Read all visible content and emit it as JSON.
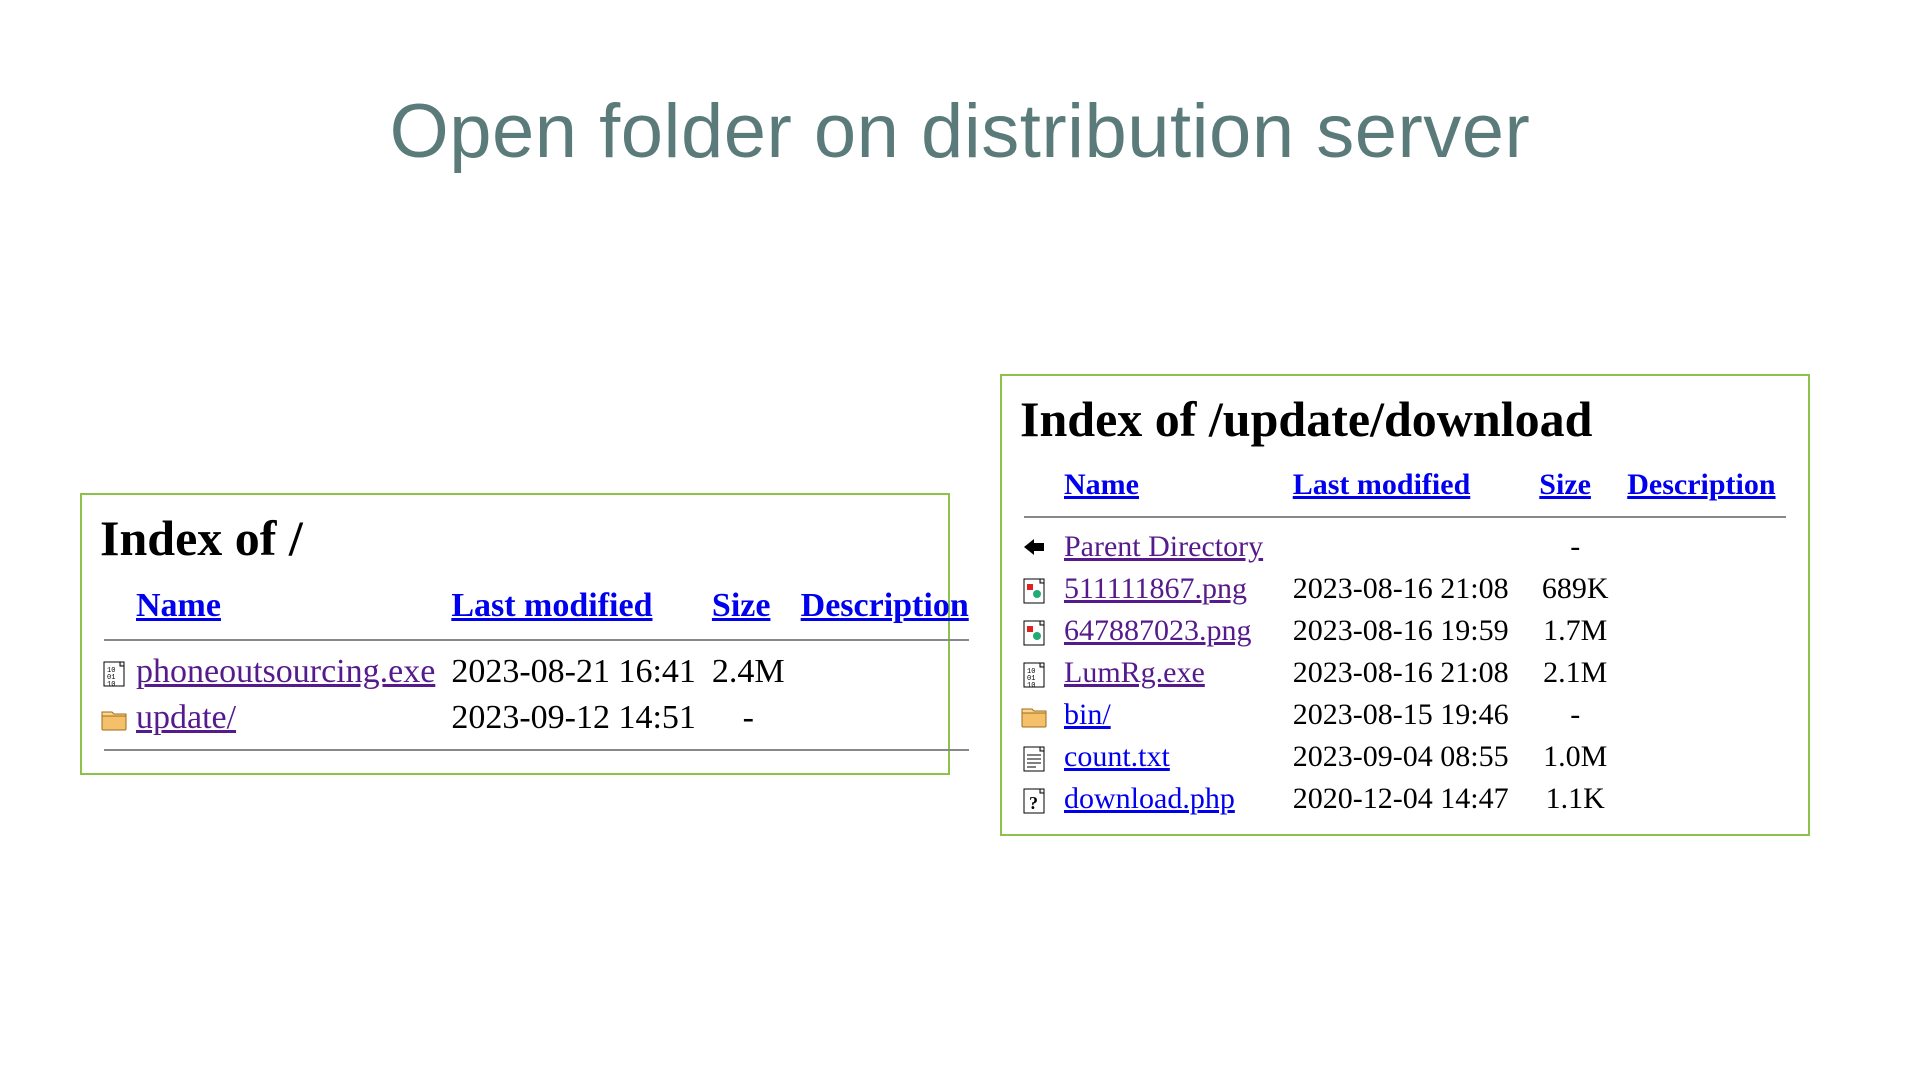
{
  "title": "Open folder on distribution server",
  "columns": {
    "name": "Name",
    "last_modified": "Last modified",
    "size": "Size",
    "description": "Description"
  },
  "left": {
    "heading": "Index of /",
    "rows": [
      {
        "icon": "binary",
        "name": "phoneoutsourcing.exe",
        "fresh": false,
        "modified": "2023-08-21 16:41",
        "size": "2.4M"
      },
      {
        "icon": "folder",
        "name": "update/",
        "fresh": false,
        "modified": "2023-09-12 14:51",
        "size": "-"
      }
    ]
  },
  "right": {
    "heading": "Index of /update/download",
    "rows": [
      {
        "icon": "back",
        "name": "Parent Directory",
        "fresh": false,
        "modified": "",
        "size": "-"
      },
      {
        "icon": "image",
        "name": "511111867.png",
        "fresh": false,
        "modified": "2023-08-16 21:08",
        "size": "689K"
      },
      {
        "icon": "image",
        "name": "647887023.png",
        "fresh": false,
        "modified": "2023-08-16 19:59",
        "size": "1.7M"
      },
      {
        "icon": "binary",
        "name": "LumRg.exe",
        "fresh": false,
        "modified": "2023-08-16 21:08",
        "size": "2.1M"
      },
      {
        "icon": "folder",
        "name": "bin/",
        "fresh": true,
        "modified": "2023-08-15 19:46",
        "size": "-"
      },
      {
        "icon": "text",
        "name": "count.txt",
        "fresh": true,
        "modified": "2023-09-04 08:55",
        "size": "1.0M"
      },
      {
        "icon": "unknown",
        "name": "download.php",
        "fresh": true,
        "modified": "2020-12-04 14:47",
        "size": "1.1K"
      }
    ]
  }
}
